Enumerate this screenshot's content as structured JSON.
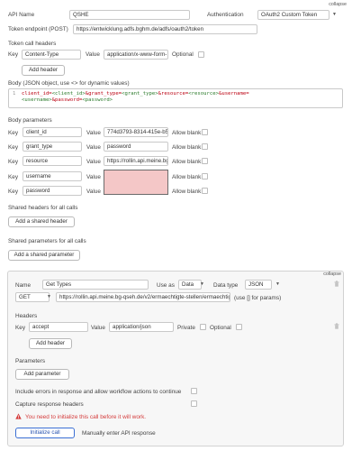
{
  "header": {
    "collapse_label": "collapse",
    "api_name_label": "API Name",
    "api_name_value": "QSHE",
    "auth_label": "Authentication",
    "auth_value": "OAuth2 Custom Token",
    "token_endpoint_label": "Token endpoint (POST)",
    "token_endpoint_value": "https://entwicklung.adfs.bghm.de/adfs/oauth2/token"
  },
  "token_headers": {
    "section_label": "Token call headers",
    "key_label": "Key",
    "key_value": "Content-Type",
    "value_label": "Value",
    "value_value": "application/x-www-form-",
    "optional_label": "Optional",
    "add_button": "Add header"
  },
  "body_json": {
    "label": "Body (JSON object, use <> for dynamic values)",
    "line_number": "1",
    "line1_parts": [
      "client_id=",
      "<client_id>",
      "&grant_type=",
      "<grant_type>",
      "&resource=",
      "<resource>",
      "&username="
    ],
    "line2_parts": [
      "<username>",
      "&password=",
      "<password>"
    ]
  },
  "body_params": {
    "section_label": "Body parameters",
    "key_label": "Key",
    "value_label": "Value",
    "allow_blank_label": "Allow blank",
    "rows": [
      {
        "key": "client_id",
        "value": "774d3793-8314-415e-b51"
      },
      {
        "key": "grant_type",
        "value": "password"
      },
      {
        "key": "resource",
        "value": "https://rollin.api.meine.bg"
      },
      {
        "key": "username",
        "value": ""
      },
      {
        "key": "password",
        "value": ""
      }
    ]
  },
  "shared": {
    "headers_label": "Shared headers for all calls",
    "add_shared_header": "Add a shared header",
    "params_label": "Shared parameters for all calls",
    "add_shared_parameter": "Add a shared parameter"
  },
  "call": {
    "collapse_label": "collapse",
    "name_label": "Name",
    "name_value": "Get Types",
    "use_as_label": "Use as",
    "use_as_value": "Data",
    "data_type_label": "Data type",
    "data_type_value": "JSON",
    "method_value": "GET",
    "url_value": "https://rollin.api.meine.bg-qseh.de/v2/ermaechtigte-stellen/ermaechtigunge",
    "url_hint": "(use [] for params)",
    "headers_label": "Headers",
    "key_label": "Key",
    "header_key": "accept",
    "value_label": "Value",
    "header_value": "application/json",
    "private_label": "Private",
    "optional_label": "Optional",
    "add_header": "Add header",
    "parameters_label": "Parameters",
    "add_parameter": "Add parameter",
    "include_errors_label": "Include errors in response and allow workflow actions to continue",
    "capture_headers_label": "Capture response headers",
    "warning_text": "You need to initialize this call before it will work.",
    "initialize_button": "Initialize call",
    "manual_entry": "Manually enter API response"
  },
  "colors": {
    "warning": "#d43b3b",
    "invalid_field": "#f4c7c7",
    "primary_button_border": "#3b6fd4"
  }
}
